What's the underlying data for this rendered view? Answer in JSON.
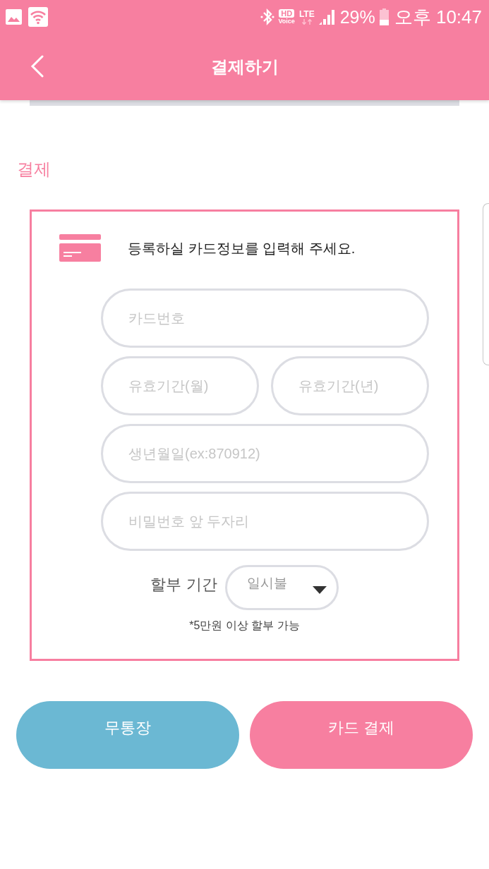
{
  "status_bar": {
    "hd_badge": "HD",
    "voice_label": "Voice",
    "network": "LTE",
    "battery": "29%",
    "time": "오후 10:47"
  },
  "header": {
    "title": "결제하기"
  },
  "section_title": "결제",
  "card_form": {
    "heading": "등록하실 카드정보를 입력해 주세요.",
    "field_rows": [
      {
        "fields": [
          {
            "placeholder": "카드번호"
          }
        ]
      },
      {
        "fields": [
          {
            "placeholder": "유효기간(월)"
          },
          {
            "placeholder": "유효기간(년)"
          }
        ]
      },
      {
        "fields": [
          {
            "placeholder": "생년월일(ex:870912)"
          }
        ]
      },
      {
        "fields": [
          {
            "placeholder": "비밀번호 앞 두자리"
          }
        ]
      }
    ],
    "installment": {
      "label": "할부 기간",
      "value": "일시불"
    },
    "note": "*5만원 이상 할부 가능"
  },
  "buttons": [
    {
      "label": "무통장",
      "kind": "bank"
    },
    {
      "label": "카드 결제",
      "kind": "card"
    }
  ]
}
